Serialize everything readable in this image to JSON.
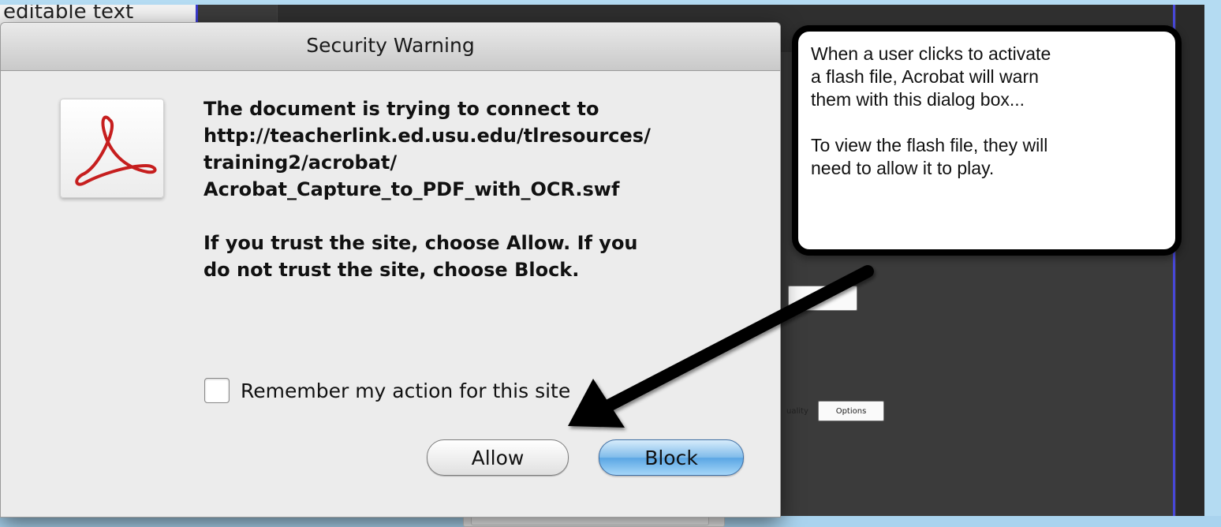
{
  "background_doc": {
    "partial_text": "editable text"
  },
  "back_dialog": {
    "quality_label": "uality",
    "options_button": "Options"
  },
  "dialog": {
    "title": "Security Warning",
    "message_lines": [
      "The document is trying to connect to",
      "http://teacherlink.ed.usu.edu/tlresources/",
      "training2/acrobat/",
      "Acrobat_Capture_to_PDF_with_OCR.swf"
    ],
    "trust_lines": [
      "If you trust the site, choose Allow. If you",
      "do not trust the site, choose Block."
    ],
    "remember_label": "Remember my action for this site",
    "remember_checked": false,
    "allow_label": "Allow",
    "block_label": "Block",
    "icon": "acrobat-logo-icon"
  },
  "callout": {
    "paragraph1_lines": [
      "When a user clicks to activate",
      "a flash file, Acrobat will warn",
      "them with this dialog box..."
    ],
    "paragraph2_lines": [
      "To view the flash file, they will",
      "need to allow it to play."
    ]
  },
  "colors": {
    "frame": "#b4dbf2",
    "dark_app": "#3b3b3b",
    "block_button": "#5aa6e4",
    "arrow": "#000000"
  }
}
